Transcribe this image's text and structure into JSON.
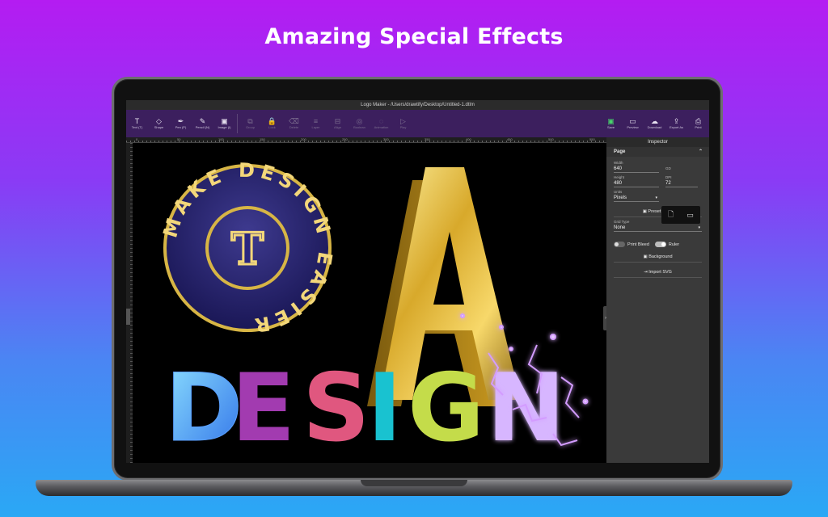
{
  "headline": "Amazing Special Effects",
  "app": {
    "window_title": "Logo Maker - /Users/drawtify/Desktop/Untitled-1.dtlm",
    "toolbar": {
      "left_tools": [
        {
          "name": "text-tool",
          "icon": "T",
          "label": "Text (T)"
        },
        {
          "name": "shape-tool",
          "icon": "◇",
          "label": "Shape"
        },
        {
          "name": "pen-tool",
          "icon": "✒",
          "label": "Pen (P)"
        },
        {
          "name": "pencil-tool",
          "icon": "✎",
          "label": "Pencil (N)"
        },
        {
          "name": "image-tool",
          "icon": "▣",
          "label": "Image (I)"
        }
      ],
      "mid_tools": [
        {
          "name": "group-tool",
          "icon": "⧉",
          "label": "Group"
        },
        {
          "name": "lock-tool",
          "icon": "🔒",
          "label": "Lock"
        },
        {
          "name": "delete-tool",
          "icon": "⌫",
          "label": "Delete"
        },
        {
          "name": "layer-tool",
          "icon": "≡",
          "label": "Layer"
        },
        {
          "name": "align-tool",
          "icon": "⊟",
          "label": "Align"
        },
        {
          "name": "boolean-tool",
          "icon": "◎",
          "label": "Boolean"
        },
        {
          "name": "animation-tool",
          "icon": "◌",
          "label": "Animation"
        },
        {
          "name": "play-tool",
          "icon": "▷",
          "label": "Play"
        }
      ],
      "right_tools": [
        {
          "name": "save-tool",
          "icon": "▣",
          "label": "Save"
        },
        {
          "name": "preview-tool",
          "icon": "▭",
          "label": "Preview"
        },
        {
          "name": "download-tool",
          "icon": "☁",
          "label": "Download"
        },
        {
          "name": "export-tool",
          "icon": "⇪",
          "label": "Export As"
        },
        {
          "name": "print-tool",
          "icon": "⎙",
          "label": "Print"
        }
      ]
    },
    "ruler_labels": [
      "0",
      "50",
      "100",
      "150",
      "200",
      "250",
      "300",
      "350",
      "400",
      "450",
      "500",
      "550"
    ],
    "canvas": {
      "badge_ring_text": "MAKE DESIGN EASIER",
      "badge_center": "T",
      "letter_3d": "A",
      "design_letters": [
        "D",
        "E",
        "S",
        "I",
        "G",
        "N"
      ]
    },
    "inspector": {
      "title": "Inspector",
      "section": "Page",
      "width_label": "Width",
      "width_value": "640",
      "height_label": "Height",
      "height_value": "480",
      "dpi_label": "DPI",
      "dpi_value": "72",
      "units_label": "Units",
      "units_value": "Pixels",
      "link_label": "GD",
      "preset_sizes": "Preset Sizes",
      "grid_type_label": "Grid Type",
      "grid_type_value": "None",
      "print_bleed": "Print Bleed",
      "ruler": "Ruler",
      "background": "Background",
      "import_svg": "Import SVG"
    }
  },
  "colors": {
    "accent_purple": "#3c1f5e",
    "save_green": "#47d36b"
  }
}
